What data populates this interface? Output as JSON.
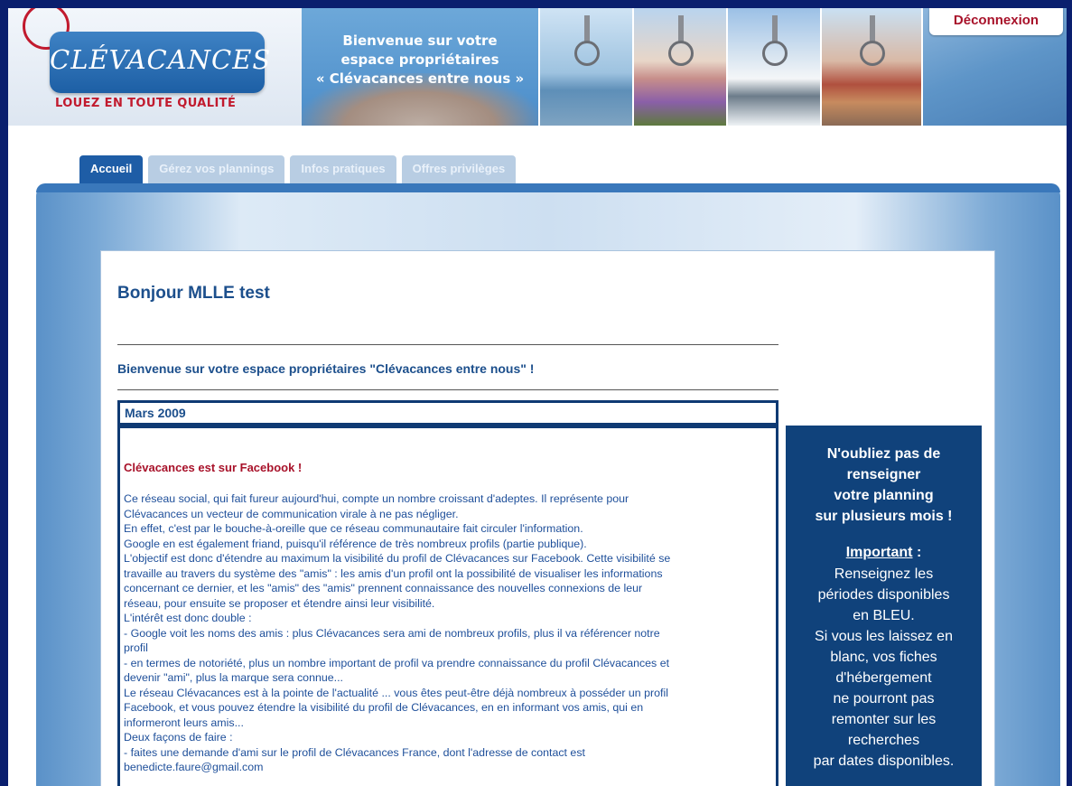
{
  "banner": {
    "logo_text": "CLÉVACANCES",
    "logo_tagline": "LOUEZ EN TOUTE QUALITÉ",
    "welcome_lines": [
      "Bienvenue sur votre",
      "espace propriétaires",
      "« Clévacances entre nous »"
    ],
    "logout_label": "Déconnexion"
  },
  "tabs": [
    {
      "label": "Accueil",
      "active": true
    },
    {
      "label": "Gérez vos plannings",
      "active": false
    },
    {
      "label": "Infos pratiques",
      "active": false
    },
    {
      "label": "Offres privilèges",
      "active": false
    }
  ],
  "main": {
    "greeting": "Bonjour MLLE test",
    "welcome": "Bienvenue sur votre espace propriétaires \"Clévacances entre nous\" !",
    "news": {
      "date": "Mars 2009",
      "title": "Clévacances est sur Facebook !",
      "lines": [
        "Ce réseau social, qui fait fureur aujourd'hui, compte un nombre croissant d'adeptes. Il représente pour",
        "Clévacances un vecteur de communication virale à ne pas négliger.",
        "En effet, c'est par le bouche-à-oreille que ce réseau communautaire fait circuler l'information.",
        "Google en est également friand, puisqu'il référence de très nombreux profils (partie publique).",
        "L'objectif est donc d'étendre au maximum la visibilité du profil de Clévacances sur Facebook. Cette visibilité se",
        "travaille au travers du système des \"amis\" : les amis d'un profil ont la possibilité de visualiser les informations",
        "concernant ce dernier, et les \"amis\" des \"amis\" prennent connaissance des nouvelles connexions de leur",
        "réseau, pour ensuite se proposer et étendre ainsi leur visibilité.",
        "L'intérêt est donc double :",
        "- Google voit les noms des amis : plus Clévacances sera ami de nombreux profils, plus il va référencer notre",
        "profil",
        "- en termes de notoriété, plus un nombre important de profil va prendre connaissance du profil Clévacances et",
        "devenir \"ami\", plus la marque sera connue...",
        "Le réseau Clévacances est à la pointe de l'actualité ... vous êtes peut-être déjà nombreux à posséder un profil",
        "Facebook, et vous pouvez étendre la visibilité du profil de Clévacances, en en informant vos amis, qui en",
        "informeront leurs amis...",
        "Deux façons de faire :",
        "- faites une demande d'ami sur le profil de Clévacances France, dont l'adresse de contact est",
        "benedicte.faure@gmail.com"
      ]
    }
  },
  "reminder": {
    "title_lines": [
      "N'oubliez pas de",
      "renseigner",
      "votre planning",
      "sur plusieurs mois !"
    ],
    "important_label": "Important",
    "important_suffix": " :",
    "body_lines": [
      "Renseignez les",
      "périodes disponibles",
      "en BLEU.",
      "Si vous les laissez en",
      "blanc, vos fiches",
      "d'hébergement",
      "ne pourront pas",
      "remonter sur les",
      "recherches",
      "par dates disponibles."
    ]
  }
}
